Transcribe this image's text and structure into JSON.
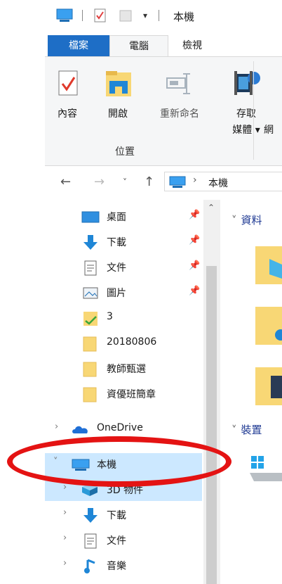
{
  "titlebar": {
    "title": "本機"
  },
  "ribbon": {
    "tabs": [
      "檔案",
      "電腦",
      "檢視"
    ],
    "buttons": {
      "properties": "內容",
      "open": "開啟",
      "rename": "重新命名",
      "access_media_line1": "存取",
      "access_media_line2": "媒體 ▾",
      "network_clip": "網"
    },
    "group_label": "位置"
  },
  "address": {
    "path_label": "本機",
    "path_sep": "›"
  },
  "nav": {
    "quick_access": [
      {
        "label": "桌面",
        "icon": "desktop-icon",
        "pinned": true
      },
      {
        "label": "下載",
        "icon": "download-icon",
        "pinned": true
      },
      {
        "label": "文件",
        "icon": "document-icon",
        "pinned": true
      },
      {
        "label": "圖片",
        "icon": "pictures-icon",
        "pinned": true
      },
      {
        "label": "3",
        "icon": "folder-check-icon",
        "pinned": false
      },
      {
        "label": "20180806",
        "icon": "folder-icon",
        "pinned": false
      },
      {
        "label": "教師甄選",
        "icon": "folder-icon",
        "pinned": false
      },
      {
        "label": "資優班簡章",
        "icon": "folder-icon",
        "pinned": false
      }
    ],
    "onedrive": "OneDrive",
    "this_pc": "本機",
    "this_pc_children": [
      {
        "label": "3D 物件",
        "icon": "3d-objects-icon"
      },
      {
        "label": "下載",
        "icon": "download-icon"
      },
      {
        "label": "文件",
        "icon": "document-icon"
      },
      {
        "label": "音樂",
        "icon": "music-icon"
      }
    ]
  },
  "content": {
    "sections": [
      "資料",
      "裝置"
    ]
  },
  "colors": {
    "file_tab": "#1e6ec6",
    "selection": "#cce8ff",
    "annotation": "#e41313",
    "folder": "#f8d775"
  }
}
